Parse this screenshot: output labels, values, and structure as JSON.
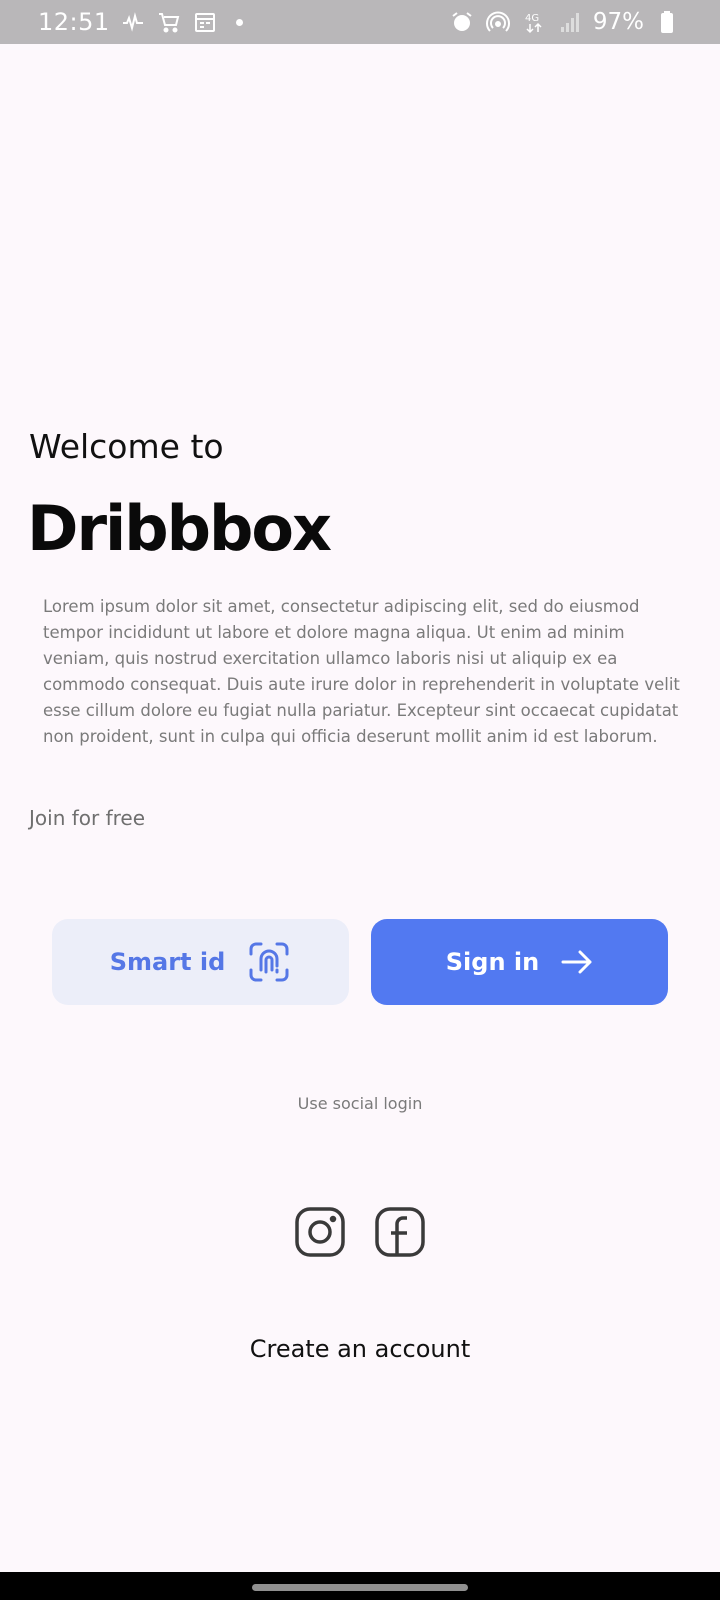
{
  "status_bar": {
    "time": "12:51",
    "battery_text": "97%",
    "left_icons": [
      "activity-icon",
      "cart-icon",
      "calendar-icon",
      "notification-dot"
    ],
    "right_icons": [
      "alarm-icon",
      "hotspot-icon",
      "4g-icon",
      "signal-icon",
      "battery-icon"
    ]
  },
  "welcome": {
    "subtitle": "Welcome to",
    "brand": "Dribbbox",
    "description": "Lorem ipsum dolor sit amet, consectetur adipiscing elit, sed do eiusmod tempor incididunt ut labore et dolore magna aliqua. Ut enim ad minim veniam, quis nostrud exercitation ullamco laboris nisi ut aliquip ex ea commodo consequat. Duis aute irure dolor in reprehenderit in voluptate velit esse cillum dolore eu fugiat nulla pariatur. Excepteur sint occaecat cupidatat non proident, sunt in culpa qui officia deserunt mollit anim id est laborum.",
    "join_text": "Join for free"
  },
  "buttons": {
    "smart_id_label": "Smart id",
    "sign_in_label": "Sign in"
  },
  "social": {
    "label": "Use social login",
    "icons": [
      "instagram-icon",
      "facebook-icon"
    ]
  },
  "create_account": "Create an account",
  "colors": {
    "background": "#fdf8fc",
    "status_bar": "#b9b7b9",
    "primary": "#5279f1",
    "primary_light": "#eceef9",
    "primary_text": "#5577e6",
    "muted_text": "#7a7a7a"
  }
}
